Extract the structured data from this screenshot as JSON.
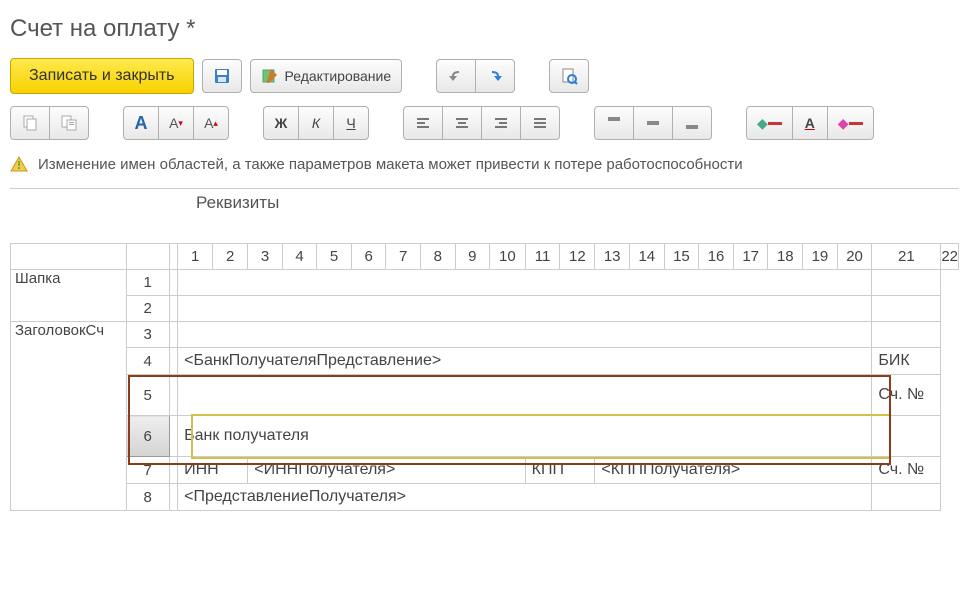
{
  "title": "Счет на оплату *",
  "toolbar": {
    "save_close": "Записать и закрыть",
    "edit": "Редактирование"
  },
  "format": {
    "font_default": "A",
    "font_small": "A",
    "font_big": "A",
    "bold": "Ж",
    "italic": "К",
    "underline": "Ч",
    "bg_color": "◆",
    "text_color": "A",
    "border_color": "◆"
  },
  "warning": "Изменение имен областей, а также параметров макета может привести к потере работоспособности",
  "region_label": "Реквизиты",
  "col_headers": [
    "",
    "1",
    "2",
    "3",
    "4",
    "5",
    "6",
    "7",
    "8",
    "9",
    "10",
    "11",
    "12",
    "13",
    "14",
    "15",
    "16",
    "17",
    "18",
    "19",
    "20",
    "21",
    "22"
  ],
  "sections": {
    "header": "Шапка",
    "title_section": "ЗаголовокСч"
  },
  "rows": {
    "r1": "1",
    "r2": "2",
    "r3": "3",
    "r4": "4",
    "r5": "5",
    "r6": "6",
    "r7": "7",
    "r8": "8"
  },
  "cells": {
    "bank_repr": "<БанкПолучателяПредставление>",
    "bik": "БИК",
    "acct": "Сч. №",
    "bank_recipient": "Банк получателя",
    "inn": "ИНН",
    "inn_val": "<ИННПолучателя>",
    "kpp": "КПП",
    "kpp_val": "<КПППолучателя>",
    "acct2": "Сч. №",
    "payee_repr": "<ПредставлениеПолучателя>"
  }
}
